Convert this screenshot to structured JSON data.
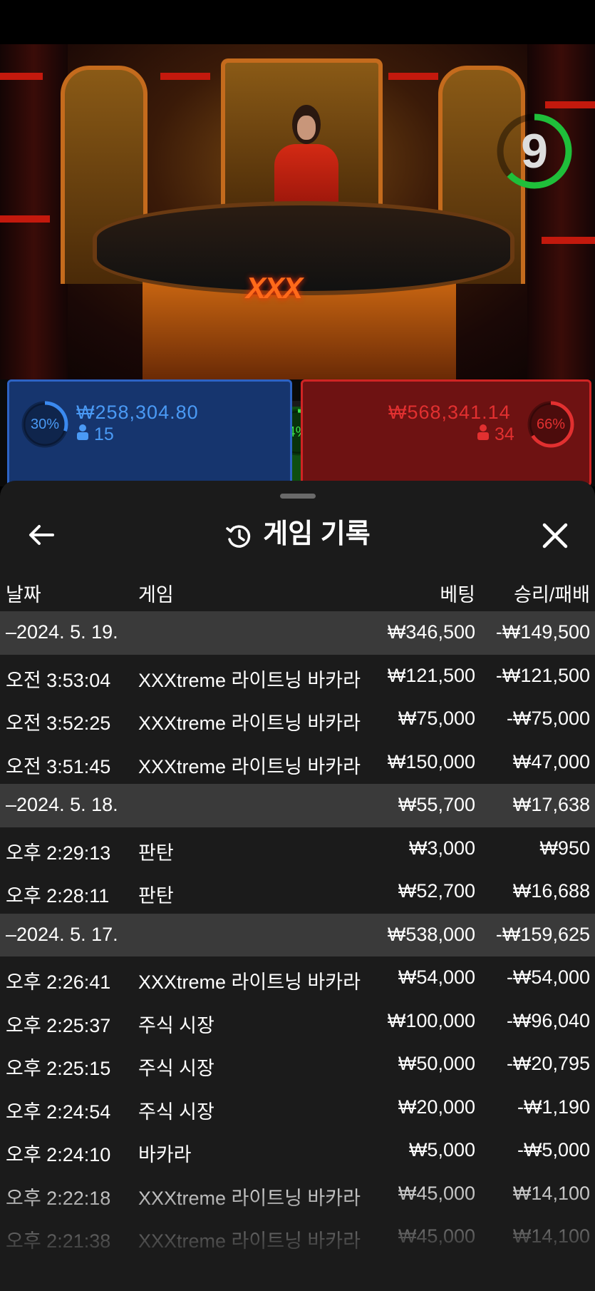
{
  "timer": {
    "value": "9"
  },
  "table_logo": "XXX",
  "bets": {
    "player": {
      "percent": "30%",
      "amount": "₩258,304.80",
      "players": "15"
    },
    "tie": {
      "percent": "4%"
    },
    "banker": {
      "percent": "66%",
      "amount": "₩568,341.14",
      "players": "34"
    }
  },
  "sheet": {
    "title": "게임 기록",
    "columns": {
      "date": "날짜",
      "game": "게임",
      "bet": "베팅",
      "result": "승리/패배"
    },
    "groups": [
      {
        "date": "–2024. 5. 19.",
        "bet": "₩346,500",
        "result": "-₩149,500",
        "rows": [
          {
            "time": "오전 3:53:04",
            "game": "XXXtreme 라이트닝 바카라",
            "bet": "₩121,500",
            "result": "-₩121,500"
          },
          {
            "time": "오전 3:52:25",
            "game": "XXXtreme 라이트닝 바카라",
            "bet": "₩75,000",
            "result": "-₩75,000"
          },
          {
            "time": "오전 3:51:45",
            "game": "XXXtreme 라이트닝 바카라",
            "bet": "₩150,000",
            "result": "₩47,000"
          }
        ]
      },
      {
        "date": "–2024. 5. 18.",
        "bet": "₩55,700",
        "result": "₩17,638",
        "rows": [
          {
            "time": "오후 2:29:13",
            "game": "판탄",
            "bet": "₩3,000",
            "result": "₩950"
          },
          {
            "time": "오후 2:28:11",
            "game": "판탄",
            "bet": "₩52,700",
            "result": "₩16,688"
          }
        ]
      },
      {
        "date": "–2024. 5. 17.",
        "bet": "₩538,000",
        "result": "-₩159,625",
        "rows": [
          {
            "time": "오후 2:26:41",
            "game": "XXXtreme 라이트닝 바카라",
            "bet": "₩54,000",
            "result": "-₩54,000"
          },
          {
            "time": "오후 2:25:37",
            "game": "주식 시장",
            "bet": "₩100,000",
            "result": "-₩96,040"
          },
          {
            "time": "오후 2:25:15",
            "game": "주식 시장",
            "bet": "₩50,000",
            "result": "-₩20,795"
          },
          {
            "time": "오후 2:24:54",
            "game": "주식 시장",
            "bet": "₩20,000",
            "result": "-₩1,190"
          },
          {
            "time": "오후 2:24:10",
            "game": "바카라",
            "bet": "₩5,000",
            "result": "-₩5,000"
          },
          {
            "time": "오후 2:22:18",
            "game": "XXXtreme 라이트닝 바카라",
            "bet": "₩45,000",
            "result": "₩14,100"
          },
          {
            "time": "오후 2:21:38",
            "game": "XXXtreme 라이트닝 바카라",
            "bet": "₩45,000",
            "result": "₩14,100"
          }
        ]
      }
    ]
  },
  "colors": {
    "player": "#2d63c4",
    "banker": "#d02424",
    "tie": "#1a8a22",
    "sheet_bg": "#1b1b1b",
    "date_row_bg": "#3a3a3a"
  }
}
